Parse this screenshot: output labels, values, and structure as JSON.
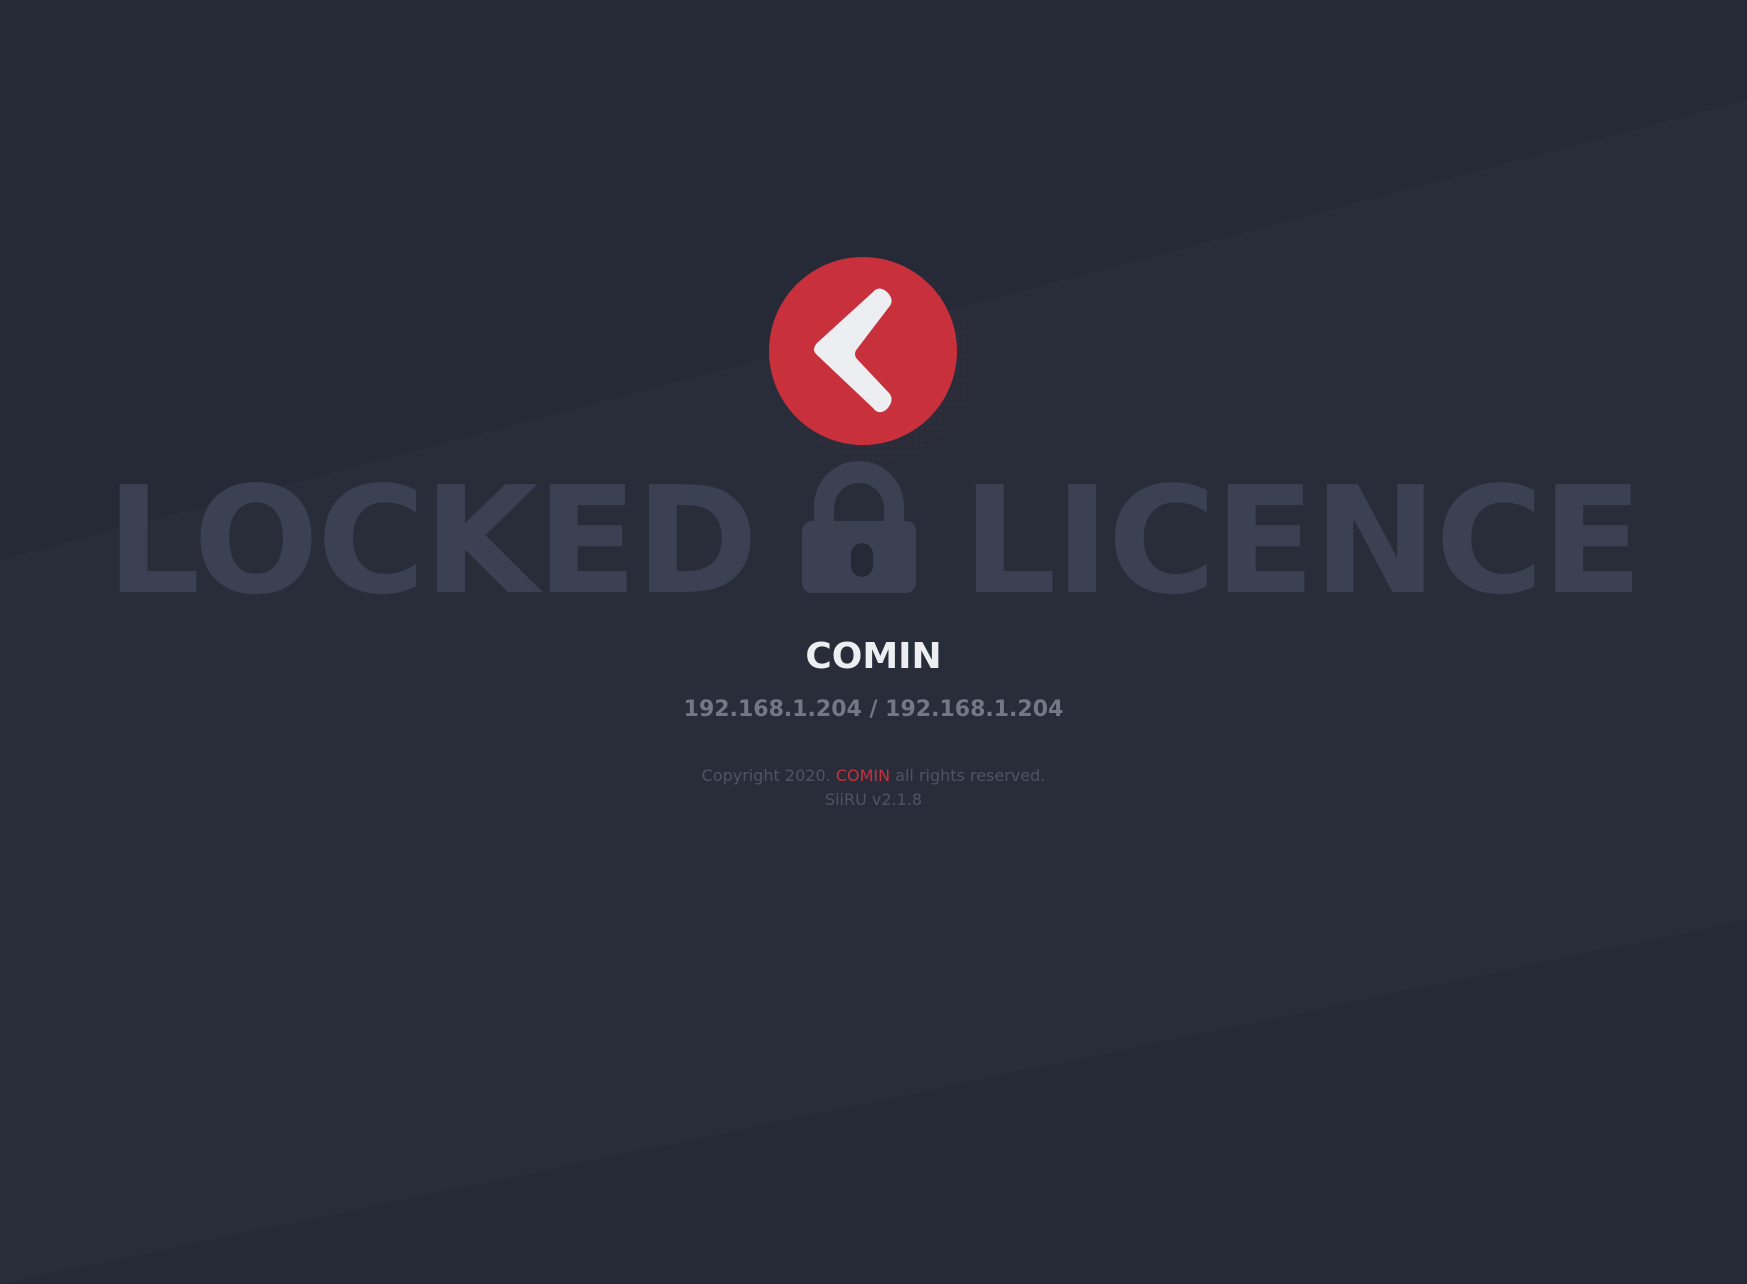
{
  "colors": {
    "background": "#262a37",
    "background_stripe": "#2a2e3b",
    "logo_red": "#c8303c",
    "logo_mark": "#eceef2",
    "headline": "#3b4152",
    "company_name": "#eceef2",
    "ip_text": "#737887",
    "footer_text": "#4f5464",
    "brand_link": "#c8303c"
  },
  "logo": {
    "icon": "comin-logo-icon"
  },
  "headline": {
    "left_word": "LOCKED",
    "right_word": "LICENCE",
    "icon": "padlock-icon"
  },
  "device": {
    "name": "COMIN",
    "ip_line": "192.168.1.204 / 192.168.1.204"
  },
  "footer": {
    "copyright_prefix": "Copyright 2020.",
    "brand": "COMIN",
    "copyright_suffix": "all rights reserved.",
    "version": "SiiRU v2.1.8"
  }
}
